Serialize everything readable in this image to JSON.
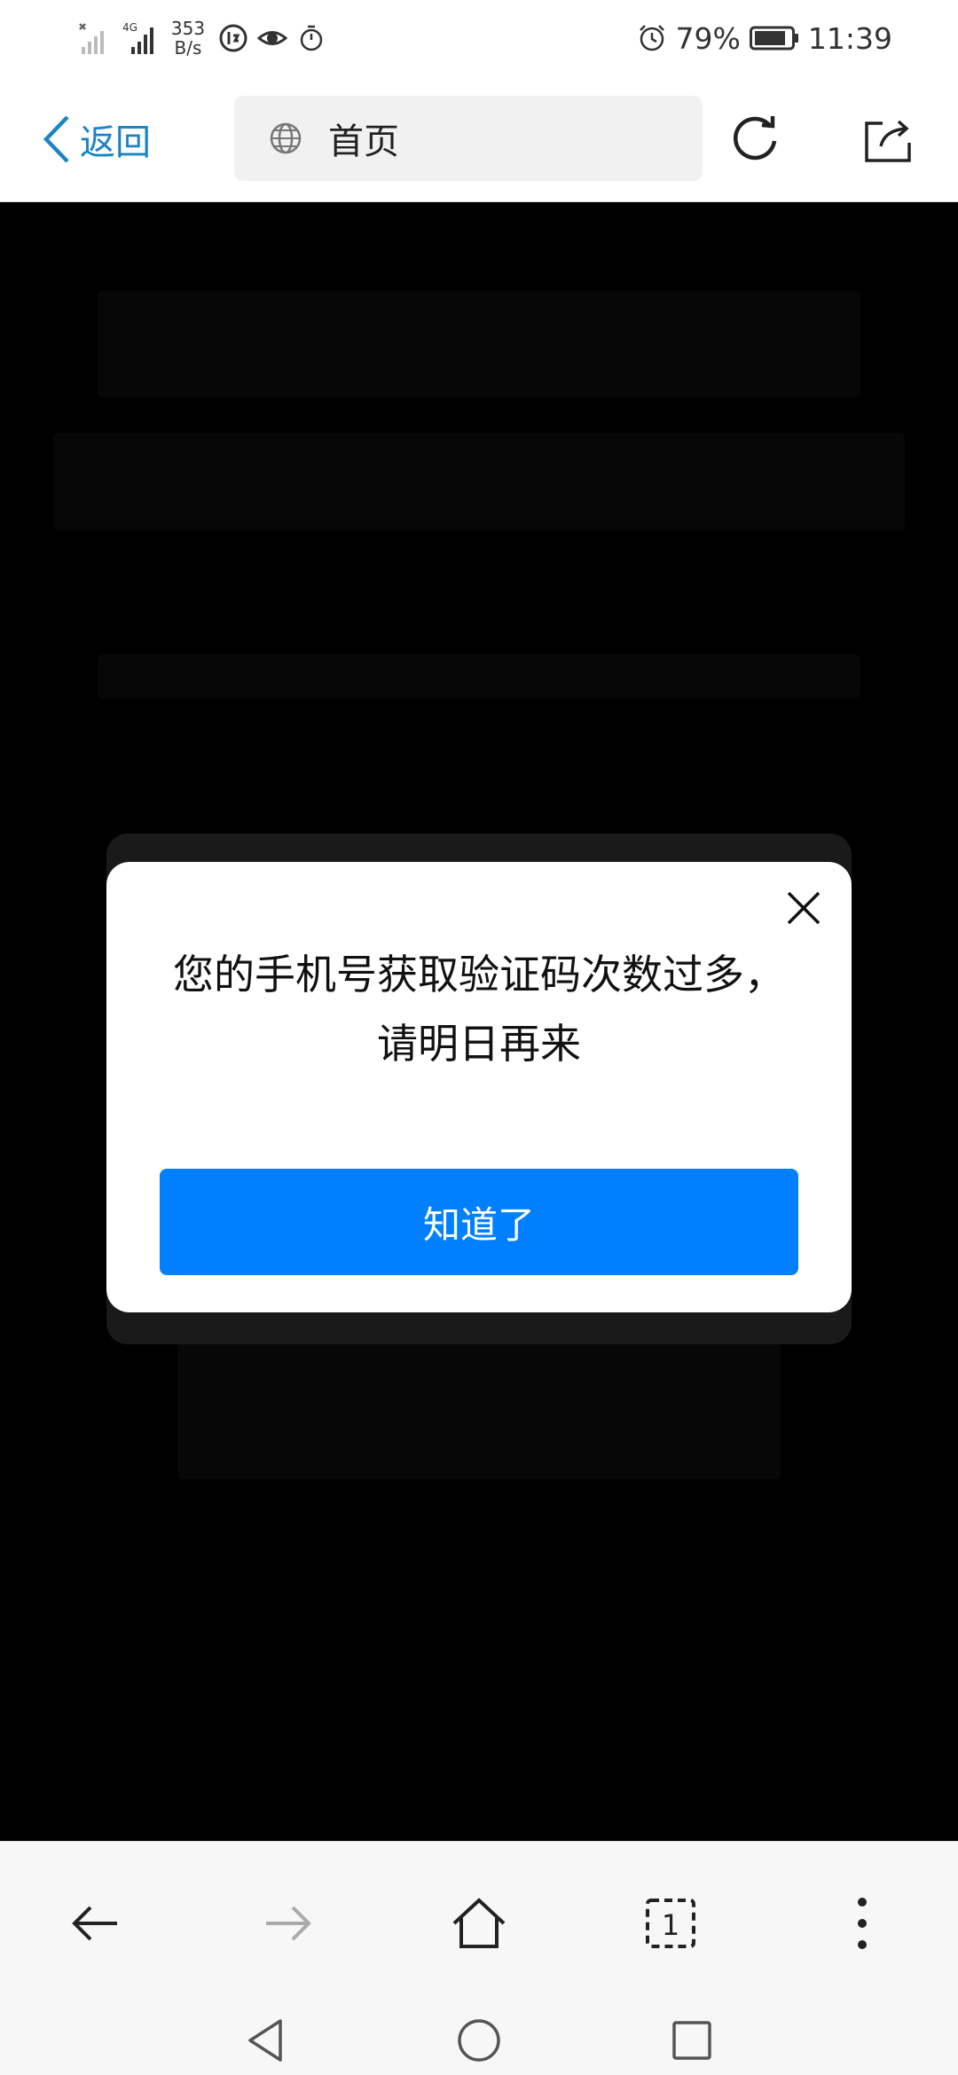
{
  "status_bar": {
    "network_speed_value": "353",
    "network_speed_unit": "B/s",
    "network_type": "4G",
    "battery_percent": "79%",
    "time": "11:39"
  },
  "header": {
    "back_label": "返回",
    "address_text": "首页"
  },
  "dialog": {
    "message_line1": "您的手机号获取验证码次数过多，",
    "message_line2": "请明日再来",
    "confirm_label": "知道了"
  },
  "toolbar": {
    "tab_count": "1"
  },
  "colors": {
    "accent": "#0080ff",
    "back_link": "#1a84c5"
  }
}
